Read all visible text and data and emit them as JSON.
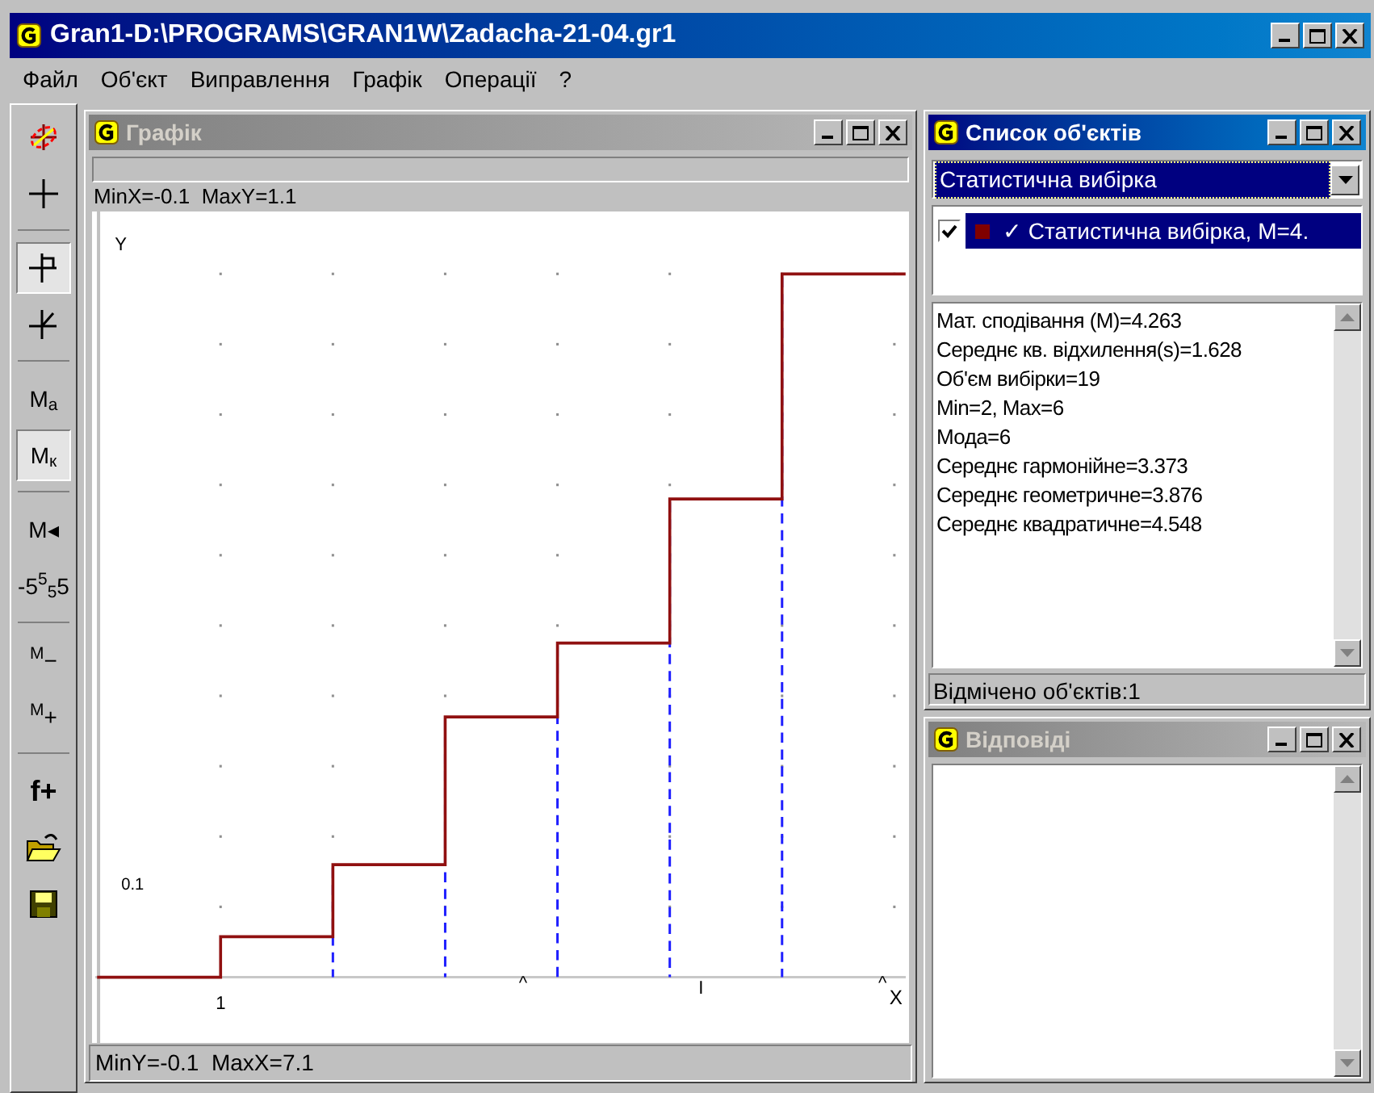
{
  "window": {
    "title": "Gran1-D:\\PROGRAMS\\GRAN1W\\Zadacha-21-04.gr1"
  },
  "menu": [
    "Файл",
    "Об'єкт",
    "Виправлення",
    "Графік",
    "Операції",
    "?"
  ],
  "toolbar": [
    [
      {
        "kind": "axes",
        "pressed": false
      },
      {
        "kind": "cross",
        "pressed": false
      }
    ],
    [
      {
        "kind": "flag-cross",
        "pressed": true
      },
      {
        "kind": "slant-cross",
        "pressed": false
      }
    ],
    [
      {
        "kind": "text",
        "label": "M$_{a}$",
        "pressed": false
      },
      {
        "kind": "text",
        "label": "M$_{к}$",
        "pressed": true
      }
    ],
    [
      {
        "kind": "text",
        "label": "M◂",
        "pressed": false
      },
      {
        "kind": "text",
        "label": "-5$^{5}$$_{5}$5",
        "pressed": false
      }
    ],
    [
      {
        "kind": "text",
        "label": "$^{M}$−",
        "pressed": false
      },
      {
        "kind": "text",
        "label": "$^{M}$+",
        "pressed": false
      }
    ],
    [
      {
        "kind": "text",
        "label": "f+",
        "pressed": false
      },
      {
        "kind": "folder",
        "pressed": false
      },
      {
        "kind": "save",
        "pressed": false
      }
    ]
  ],
  "graph_window": {
    "title": "Графік",
    "active": false,
    "top_status": "MinX=-0.1  MaxY=1.1",
    "bottom_status": "MinY=-0.1  MaxX=7.1",
    "plot": {
      "y_axis_label": "Y",
      "x_axis_label": "X",
      "y_tick_label": "0.1",
      "x_tick_labels": [
        "1",
        "^",
        "I",
        "^"
      ]
    }
  },
  "objects_window": {
    "title": "Список об'єктів",
    "active": true,
    "dropdown": {
      "value": "Статистична вибірка"
    },
    "items": [
      {
        "checked": true,
        "color": "#800000",
        "label": "✓ Статистична вибірка, M=4.",
        "selected": true
      }
    ],
    "details": [
      "Мат. сподівання (M)=4.263",
      "Середнє кв. відхилення(s)=1.628",
      "Об'єм вибірки=19",
      "Min=2, Max=6",
      "Мода=6",
      "Середнє гармонійне=3.373",
      "Середнє геометричне=3.876",
      "Середнє квадратичне=4.548"
    ],
    "status": "Відмічено об'єктів:1"
  },
  "answers_window": {
    "title": "Відповіді",
    "active": false
  }
}
